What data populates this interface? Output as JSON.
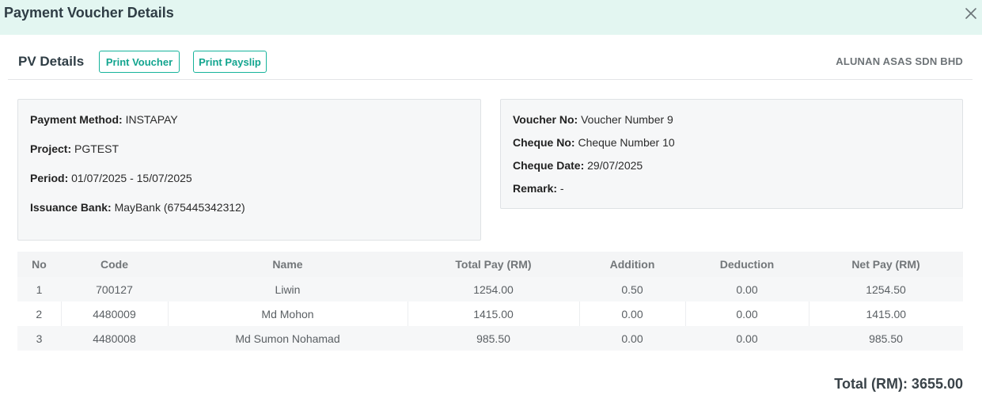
{
  "header": {
    "title": "Payment Voucher Details",
    "close_icon": "close-icon"
  },
  "toolbar": {
    "section_title": "PV Details",
    "print_voucher_label": "Print Voucher",
    "print_payslip_label": "Print Payslip",
    "company": "ALUNAN ASAS SDN BHD"
  },
  "details_left": {
    "payment_method_label": "Payment Method:",
    "payment_method": "INSTAPAY",
    "project_label": "Project:",
    "project": "PGTEST",
    "period_label": "Period:",
    "period": "01/07/2025 - 15/07/2025",
    "bank_label": "Issuance Bank:",
    "bank": "MayBank (675445342312)"
  },
  "details_right": {
    "voucher_no_label": "Voucher No:",
    "voucher_no": "Voucher Number 9",
    "cheque_no_label": "Cheque No:",
    "cheque_no": "Cheque Number 10",
    "cheque_date_label": "Cheque Date:",
    "cheque_date": "29/07/2025",
    "remark_label": "Remark:",
    "remark": "-"
  },
  "table": {
    "headers": [
      "No",
      "Code",
      "Name",
      "Total Pay (RM)",
      "Addition",
      "Deduction",
      "Net Pay (RM)"
    ],
    "rows": [
      [
        "1",
        "700127",
        "Liwin",
        "1254.00",
        "0.50",
        "0.00",
        "1254.50"
      ],
      [
        "2",
        "4480009",
        "Md Mohon",
        "1415.00",
        "0.00",
        "0.00",
        "1415.00"
      ],
      [
        "3",
        "4480008",
        "Md Sumon Nohamad",
        "985.50",
        "0.00",
        "0.00",
        "985.50"
      ]
    ]
  },
  "summary": {
    "total": "Total (RM): 3655.00"
  },
  "colors": {
    "header_bg": "#e3f6f1",
    "accent": "#16b39b"
  }
}
